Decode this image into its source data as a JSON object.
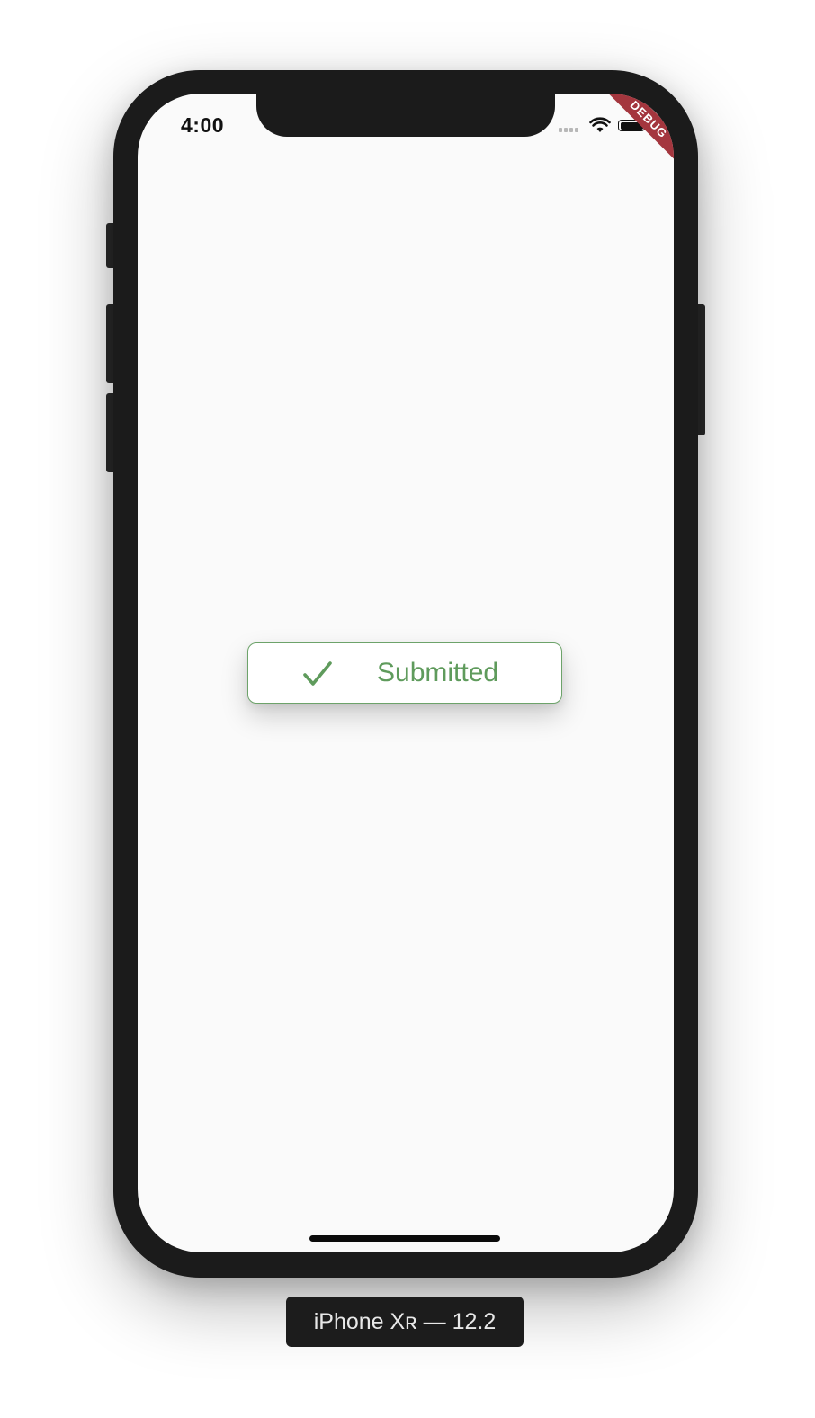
{
  "status_bar": {
    "time": "4:00",
    "signal_icon": "cellular-signal-icon",
    "wifi_icon": "wifi-icon",
    "battery_icon": "battery-icon"
  },
  "debug_banner": {
    "label": "DEBUG",
    "color": "#a4363e"
  },
  "main": {
    "submit_button": {
      "icon": "checkmark-icon",
      "label": "Submitted",
      "accent_color": "#5f9b5c"
    }
  },
  "device": {
    "label": "iPhone Xʀ — 12.2"
  }
}
